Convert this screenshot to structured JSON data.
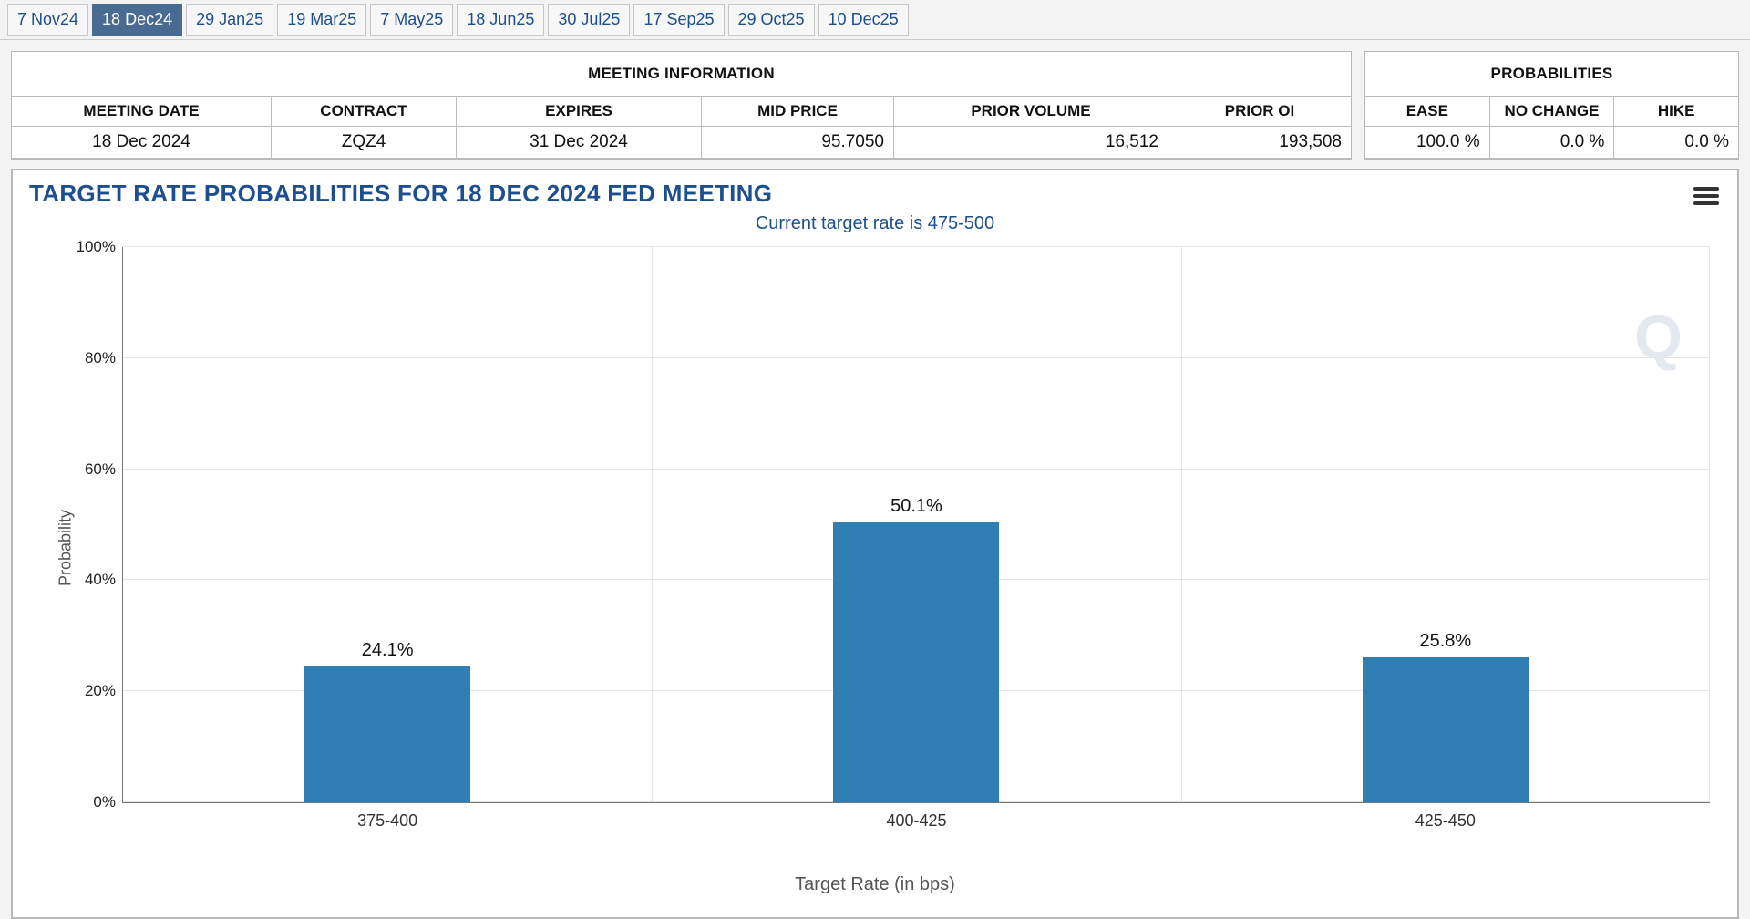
{
  "tabs": [
    {
      "label": "7 Nov24",
      "active": false
    },
    {
      "label": "18 Dec24",
      "active": true
    },
    {
      "label": "29 Jan25",
      "active": false
    },
    {
      "label": "19 Mar25",
      "active": false
    },
    {
      "label": "7 May25",
      "active": false
    },
    {
      "label": "18 Jun25",
      "active": false
    },
    {
      "label": "30 Jul25",
      "active": false
    },
    {
      "label": "17 Sep25",
      "active": false
    },
    {
      "label": "29 Oct25",
      "active": false
    },
    {
      "label": "10 Dec25",
      "active": false
    }
  ],
  "meeting_table": {
    "title": "MEETING INFORMATION",
    "headers": [
      "MEETING DATE",
      "CONTRACT",
      "EXPIRES",
      "MID PRICE",
      "PRIOR VOLUME",
      "PRIOR OI"
    ],
    "row": [
      "18 Dec 2024",
      "ZQZ4",
      "31 Dec 2024",
      "95.7050",
      "16,512",
      "193,508"
    ]
  },
  "prob_table": {
    "title": "PROBABILITIES",
    "headers": [
      "EASE",
      "NO CHANGE",
      "HIKE"
    ],
    "row": [
      "100.0 %",
      "0.0 %",
      "0.0 %"
    ]
  },
  "chart_title": "TARGET RATE PROBABILITIES FOR 18 DEC 2024 FED MEETING",
  "chart_subtitle": "Current target rate is 475-500",
  "y_axis_label": "Probability",
  "x_axis_label": "Target Rate (in bps)",
  "watermark": "Q",
  "chart_data": {
    "type": "bar",
    "categories": [
      "375-400",
      "400-425",
      "425-450"
    ],
    "values": [
      24.1,
      50.1,
      25.8
    ],
    "value_labels": [
      "24.1%",
      "50.1%",
      "25.8%"
    ],
    "title": "TARGET RATE PROBABILITIES FOR 18 DEC 2024 FED MEETING",
    "subtitle": "Current target rate is 475-500",
    "xlabel": "Target Rate (in bps)",
    "ylabel": "Probability",
    "ylim": [
      0,
      100
    ],
    "yticks": [
      0,
      20,
      40,
      60,
      80,
      100
    ],
    "ytick_labels": [
      "0%",
      "20%",
      "40%",
      "60%",
      "80%",
      "100%"
    ]
  }
}
